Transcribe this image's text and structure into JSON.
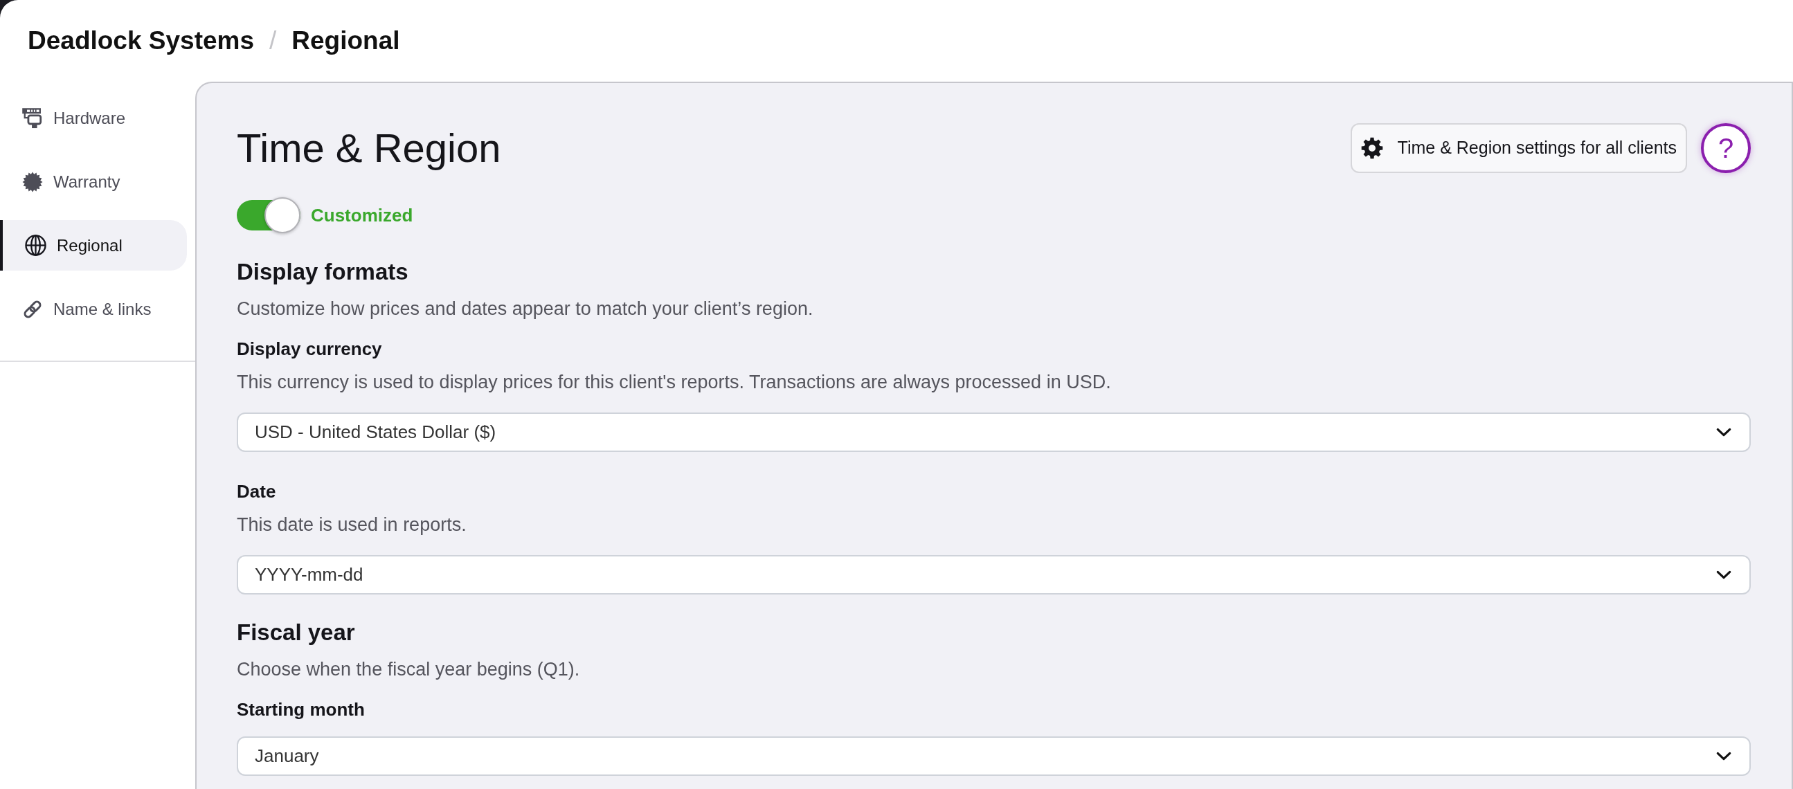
{
  "breadcrumb": {
    "items": [
      {
        "label": "Deadlock Systems"
      },
      {
        "label": "Regional"
      }
    ],
    "separator": "/"
  },
  "sidebar": {
    "items": [
      {
        "label": "Hardware",
        "selected": false
      },
      {
        "label": "Warranty",
        "selected": false
      },
      {
        "label": "Regional",
        "selected": true
      },
      {
        "label": "Name & links",
        "selected": false
      }
    ]
  },
  "page": {
    "title": "Time & Region",
    "settings_button": "Time & Region settings for all clients",
    "help_button": "?",
    "customized_toggle": {
      "label": "Customized",
      "on": true
    },
    "sections": [
      {
        "heading": "Display formats",
        "description": "Customize how prices and dates appear to match your client’s region.",
        "fields": [
          {
            "label": "Display currency",
            "hint": "This currency is used to display prices for this client's reports. Transactions are always processed in USD.",
            "value": "USD - United States Dollar ($)"
          },
          {
            "label": "Date",
            "hint": "This date is used in reports.",
            "value": "YYYY-mm-dd"
          }
        ]
      },
      {
        "heading": "Fiscal year",
        "description": "Choose when the fiscal year begins (Q1).",
        "fields": [
          {
            "label": "Starting month",
            "value": "January"
          }
        ]
      }
    ]
  }
}
